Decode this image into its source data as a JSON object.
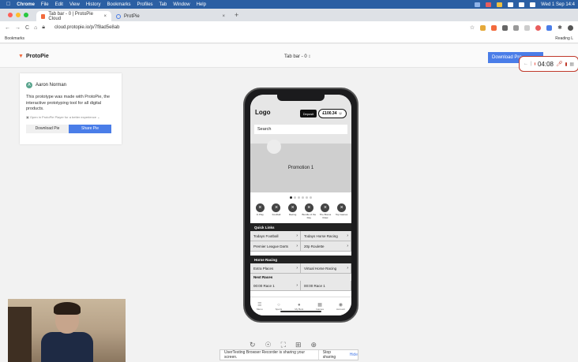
{
  "menubar": {
    "items": [
      "Chrome",
      "File",
      "Edit",
      "View",
      "History",
      "Bookmarks",
      "Profiles",
      "Tab",
      "Window",
      "Help"
    ],
    "clock": "Wed 1 Sep 14:4"
  },
  "tabs": [
    {
      "label": "Tab bar - 0 | ProtoPie Cloud",
      "active": true
    },
    {
      "label": "ProtPie",
      "active": false
    }
  ],
  "address": {
    "url": "cloud.protopie.io/p/7f8ad5e8ab"
  },
  "bookmarks": {
    "label": "Bookmarks",
    "reading_list": "Reading L"
  },
  "app": {
    "logo": "ProtoPie",
    "title": "Tab bar - 0",
    "download_label": "Download Pro"
  },
  "recorder": {
    "time": "04:08"
  },
  "card": {
    "avatar_letter": "A",
    "user": "Aaron Norman",
    "description": "This prototype was made with ProtoPie, the interactive prototyping tool for all digital products.",
    "hint": "Open in ProtoPie Player for a better experience",
    "download_btn": "Download Pie",
    "share_btn": "Share Pie"
  },
  "phone": {
    "logo": "Logo",
    "deposit": "Deposit",
    "balance": "£100.34",
    "search": "Search",
    "promotion": "Promotion 1",
    "categories": [
      {
        "label": "In Play"
      },
      {
        "label": "Football"
      },
      {
        "label": "Racing"
      },
      {
        "label": "Bundle of the Day"
      },
      {
        "label": "The Bonus Draw"
      },
      {
        "label": "Top Games"
      }
    ],
    "quick_links_title": "Quick Links",
    "quick_links": [
      [
        "Todays Football",
        "Todays Horse Racing"
      ],
      [
        "Premier League Darts",
        "20p Roulette"
      ]
    ],
    "horse_racing_title": "Horse Racing",
    "horse_racing": [
      [
        "Extra Places",
        "Virtual Horse Racing"
      ]
    ],
    "next_races_title": "Next Races",
    "next_races": [
      [
        "00:00 Race 1",
        "00:00 Race 1"
      ]
    ],
    "nav": [
      "Menu",
      "Sports",
      "My Bets",
      "Games",
      "Account"
    ]
  },
  "share_bar": {
    "text": "UserTesting Browser Recorder is sharing your screen.",
    "stop": "Stop sharing",
    "hide": "Hide"
  },
  "colors": {
    "accent": "#4a7de8",
    "brand": "#f26a3d",
    "record": "#c0392b"
  }
}
